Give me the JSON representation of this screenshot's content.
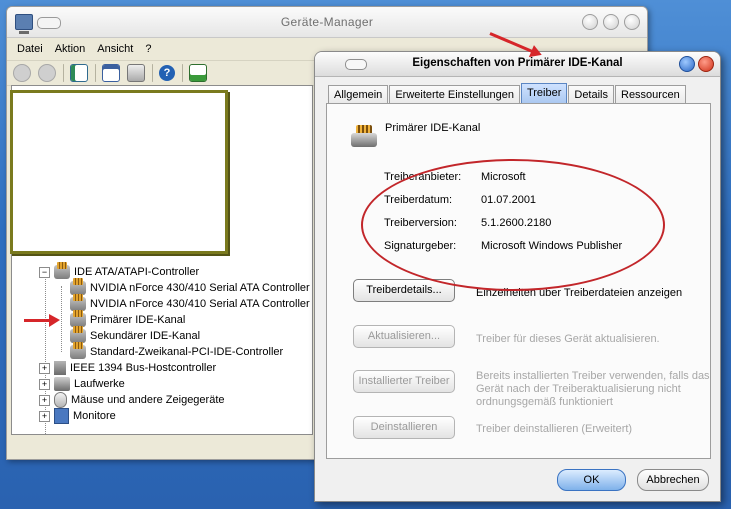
{
  "device_manager": {
    "title": "Geräte-Manager",
    "menu": [
      "Datei",
      "Aktion",
      "Ansicht",
      "?"
    ],
    "toolbar_icons": [
      "back-icon",
      "forward-icon",
      "properties-icon",
      "view-icon",
      "print-icon",
      "help-icon",
      "scan-hardware-icon"
    ],
    "tree": {
      "group_label": "IDE ATA/ATAPI-Controller",
      "children": [
        "NVIDIA nForce 430/410 Serial ATA Controller",
        "NVIDIA nForce 430/410 Serial ATA Controller",
        "Primärer IDE-Kanal",
        "Sekundärer IDE-Kanal",
        "Standard-Zweikanal-PCI-IDE-Controller"
      ],
      "other_groups": [
        "IEEE 1394 Bus-Hostcontroller",
        "Laufwerke",
        "Mäuse und andere Zeigegeräte",
        "Monitore"
      ]
    }
  },
  "dialog": {
    "title": "Eigenschaften von Primärer IDE-Kanal",
    "tabs": [
      "Allgemein",
      "Erweiterte Einstellungen",
      "Treiber",
      "Details",
      "Ressourcen"
    ],
    "active_tab": "Treiber",
    "device_name": "Primärer IDE-Kanal",
    "info": [
      {
        "label": "Treiberanbieter:",
        "value": "Microsoft"
      },
      {
        "label": "Treiberdatum:",
        "value": "01.07.2001"
      },
      {
        "label": "Treiberversion:",
        "value": "5.1.2600.2180"
      },
      {
        "label": "Signaturgeber:",
        "value": "Microsoft Windows Publisher"
      }
    ],
    "buttons": [
      {
        "label": "Treiberdetails...",
        "desc": "Einzelheiten über Treiberdateien anzeigen",
        "enabled": true
      },
      {
        "label": "Aktualisieren...",
        "desc": "Treiber für dieses Gerät aktualisieren.",
        "enabled": false
      },
      {
        "label": "Installierter Treiber",
        "desc": "Bereits installierten Treiber verwenden, falls das Gerät nach der Treiberaktualisierung nicht ordnungsgemäß funktioniert",
        "enabled": false
      },
      {
        "label": "Deinstallieren",
        "desc": "Treiber deinstallieren (Erweitert)",
        "enabled": false
      }
    ],
    "ok_label": "OK",
    "cancel_label": "Abbrechen"
  },
  "colors": {
    "annotation_red": "#d6262a",
    "active_tab_blue": "#a9c7f0"
  }
}
